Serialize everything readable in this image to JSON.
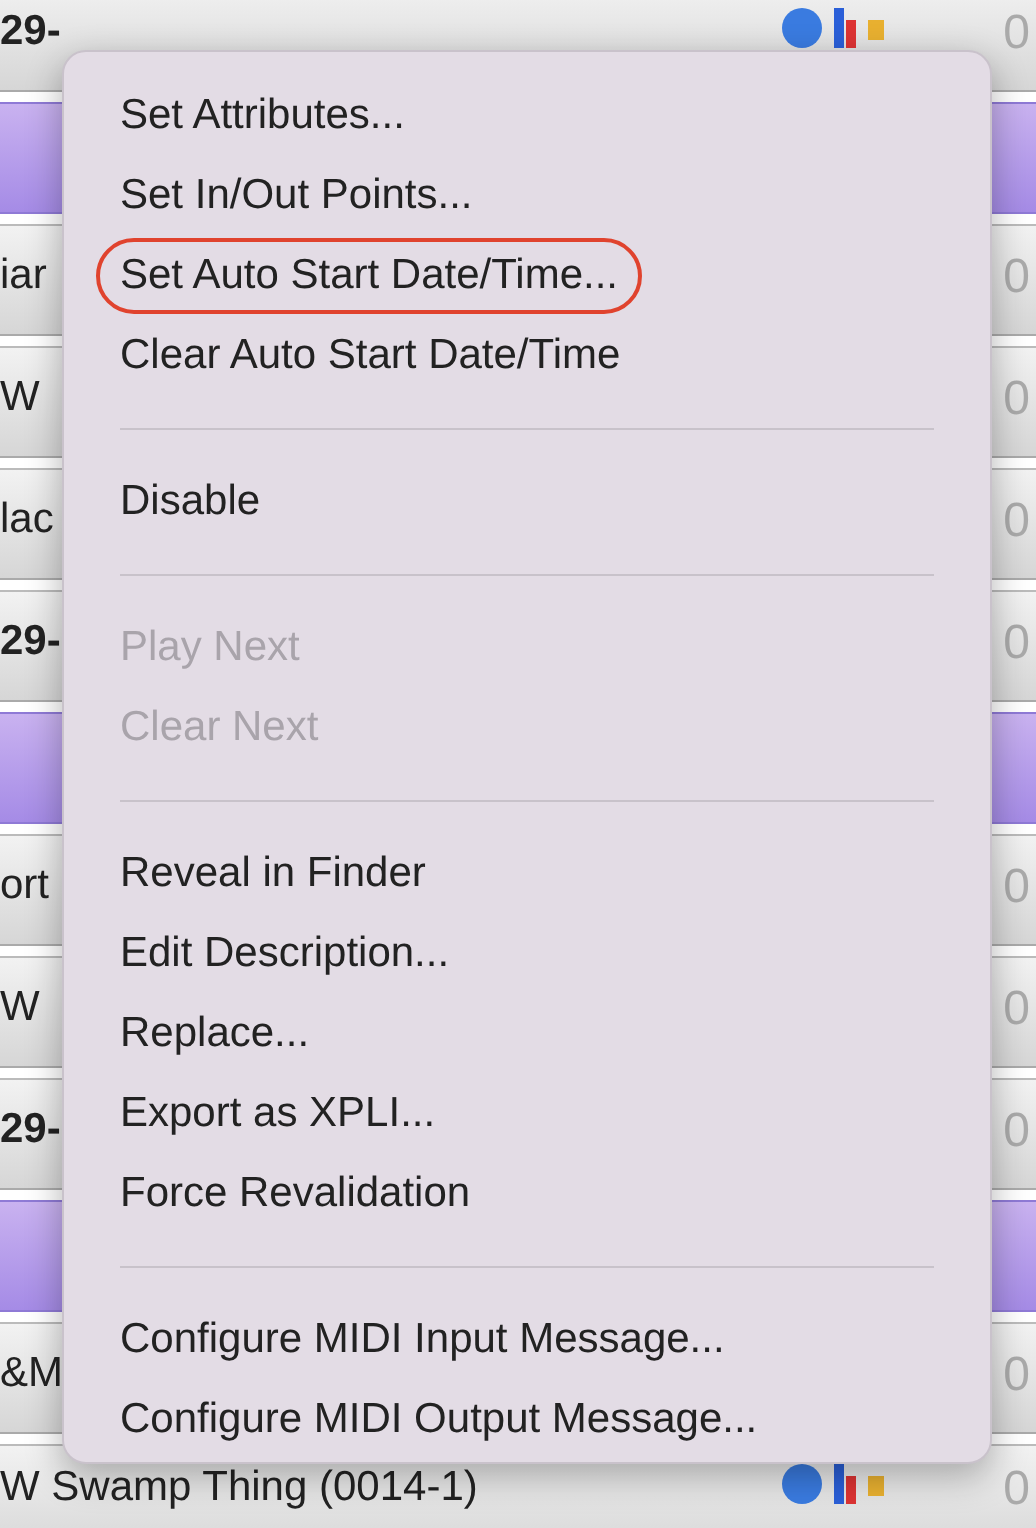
{
  "list_rows": [
    {
      "kind": "cue",
      "text": "29-",
      "bold": true,
      "time": "0",
      "icons": true
    },
    {
      "kind": "group"
    },
    {
      "kind": "cue",
      "text": "iar",
      "bold": false,
      "time": "0"
    },
    {
      "kind": "cue",
      "text": "W",
      "bold": false,
      "time": "0"
    },
    {
      "kind": "cue",
      "text": "lac",
      "bold": false,
      "time": "0"
    },
    {
      "kind": "cue",
      "text": "29-",
      "bold": true,
      "time": "0"
    },
    {
      "kind": "group"
    },
    {
      "kind": "cue",
      "text": "ort",
      "bold": false,
      "time": "0"
    },
    {
      "kind": "cue",
      "text": "W",
      "bold": false,
      "time": "0"
    },
    {
      "kind": "cue",
      "text": "29-",
      "bold": true,
      "time": "0"
    },
    {
      "kind": "group"
    },
    {
      "kind": "cue",
      "text": "&M",
      "bold": false,
      "time": "0"
    },
    {
      "kind": "cue",
      "text": "W Swamp Thing (0014-1)",
      "bold": false,
      "time": "0",
      "icons": true
    }
  ],
  "context_menu": [
    {
      "kind": "item",
      "label": "Set Attributes...",
      "disabled": false,
      "annotated": false
    },
    {
      "kind": "item",
      "label": "Set In/Out Points...",
      "disabled": false,
      "annotated": false
    },
    {
      "kind": "item",
      "label": "Set Auto Start Date/Time...",
      "disabled": false,
      "annotated": true
    },
    {
      "kind": "item",
      "label": "Clear Auto Start Date/Time",
      "disabled": false,
      "annotated": false
    },
    {
      "kind": "separator"
    },
    {
      "kind": "item",
      "label": "Disable",
      "disabled": false,
      "annotated": false
    },
    {
      "kind": "separator"
    },
    {
      "kind": "item",
      "label": "Play Next",
      "disabled": true,
      "annotated": false
    },
    {
      "kind": "item",
      "label": "Clear Next",
      "disabled": true,
      "annotated": false
    },
    {
      "kind": "separator"
    },
    {
      "kind": "item",
      "label": "Reveal in Finder",
      "disabled": false,
      "annotated": false
    },
    {
      "kind": "item",
      "label": "Edit Description...",
      "disabled": false,
      "annotated": false
    },
    {
      "kind": "item",
      "label": "Replace...",
      "disabled": false,
      "annotated": false
    },
    {
      "kind": "item",
      "label": "Export as XPLI...",
      "disabled": false,
      "annotated": false
    },
    {
      "kind": "item",
      "label": "Force Revalidation",
      "disabled": false,
      "annotated": false
    },
    {
      "kind": "separator"
    },
    {
      "kind": "item",
      "label": "Configure MIDI Input Message...",
      "disabled": false,
      "annotated": false
    },
    {
      "kind": "item",
      "label": "Configure MIDI Output Message...",
      "disabled": false,
      "annotated": false
    }
  ]
}
